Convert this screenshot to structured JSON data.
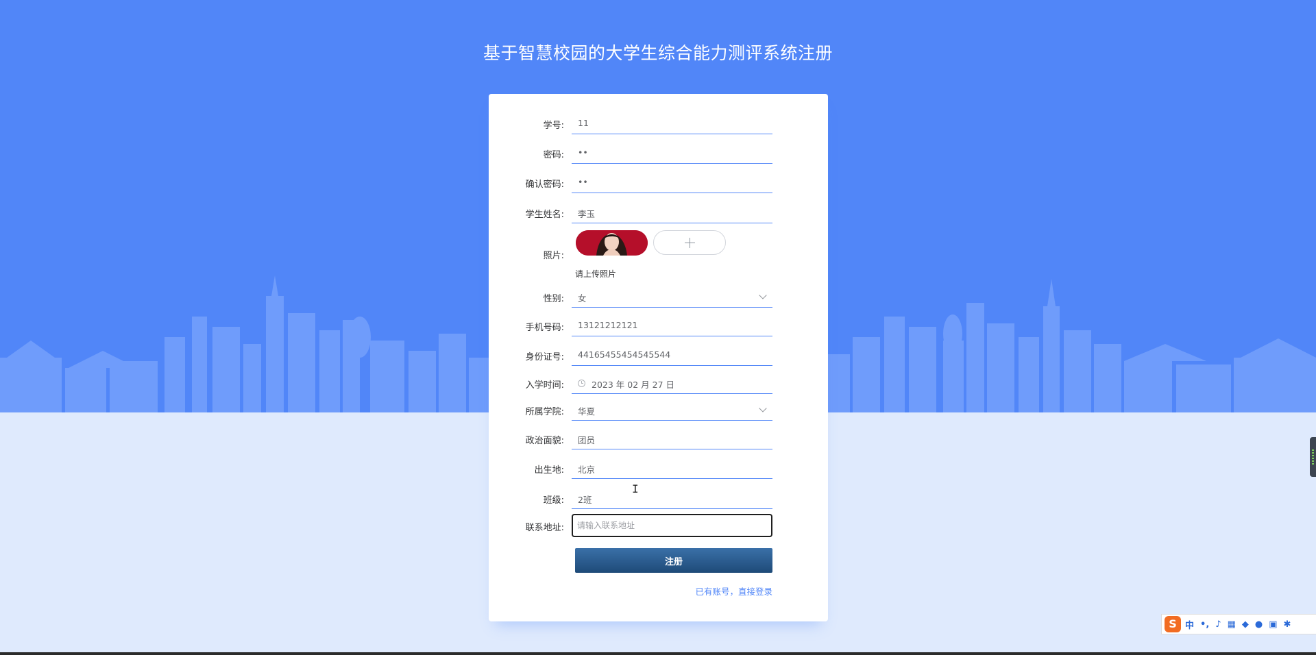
{
  "page": {
    "title": "基于智慧校园的大学生综合能力测评系统注册"
  },
  "form": {
    "student_id": {
      "label": "学号:",
      "value": "11"
    },
    "password": {
      "label": "密码:",
      "value": "••"
    },
    "confirm_password": {
      "label": "确认密码:",
      "value": "••"
    },
    "student_name": {
      "label": "学生姓名:",
      "value": "李玉"
    },
    "photo": {
      "label": "照片:",
      "hint": "请上传照片"
    },
    "gender": {
      "label": "性别:",
      "value": "女"
    },
    "phone": {
      "label": "手机号码:",
      "value": "13121212121"
    },
    "id_card": {
      "label": "身份证号:",
      "value": "44165455454545544"
    },
    "enroll_date": {
      "label": "入学时间:",
      "value": "2023 年 02 月 27 日"
    },
    "college": {
      "label": "所属学院:",
      "value": "华夏"
    },
    "political_status": {
      "label": "政治面貌:",
      "value": "团员"
    },
    "birthplace": {
      "label": "出生地:",
      "value": "北京"
    },
    "class_name": {
      "label": "班级:",
      "value": "2班"
    },
    "address": {
      "label": "联系地址:",
      "placeholder": "请输入联系地址"
    },
    "submit_label": "注册",
    "login_link": "已有账号，直接登录"
  },
  "taskbar": {
    "ime_logo": "S",
    "ime_mode": "中"
  },
  "colors": {
    "primary": "#5186f8",
    "page_bg": "#dfeafd",
    "button_dark": "#1e4a78"
  }
}
